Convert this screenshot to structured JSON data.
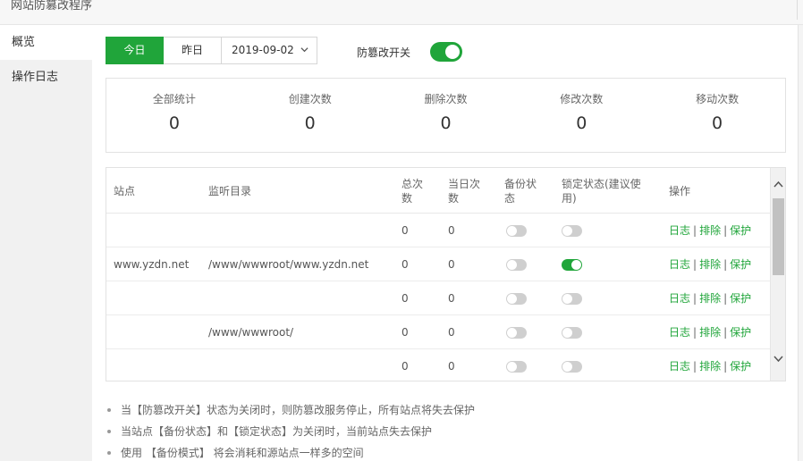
{
  "window": {
    "title": "网站防篡改程序"
  },
  "sidebar": {
    "items": [
      {
        "label": "概览",
        "active": true
      },
      {
        "label": "操作日志",
        "active": false
      }
    ]
  },
  "toolbar": {
    "today_label": "今日",
    "yesterday_label": "昨日",
    "date_value": "2019-09-02",
    "tamper_switch_label": "防篡改开关",
    "tamper_switch_on": true
  },
  "stats": [
    {
      "label": "全部统计",
      "value": "0"
    },
    {
      "label": "创建次数",
      "value": "0"
    },
    {
      "label": "删除次数",
      "value": "0"
    },
    {
      "label": "修改次数",
      "value": "0"
    },
    {
      "label": "移动次数",
      "value": "0"
    }
  ],
  "table": {
    "headers": {
      "site": "站点",
      "dir": "监听目录",
      "total": "总次数",
      "today": "当日次数",
      "backup": "备份状态",
      "lock": "锁定状态(建议使用)",
      "ops": "操作"
    },
    "rows": [
      {
        "site": "",
        "dir": "",
        "total": "0",
        "today": "0",
        "backup_on": false,
        "lock_on": false
      },
      {
        "site": "www.yzdn.net",
        "dir": "/www/wwwroot/www.yzdn.net",
        "total": "0",
        "today": "0",
        "backup_on": false,
        "lock_on": true
      },
      {
        "site": "",
        "dir": "",
        "total": "0",
        "today": "0",
        "backup_on": false,
        "lock_on": false
      },
      {
        "site": "",
        "dir": "/www/wwwroot/",
        "total": "0",
        "today": "0",
        "backup_on": false,
        "lock_on": false
      },
      {
        "site": "",
        "dir": "",
        "total": "0",
        "today": "0",
        "backup_on": false,
        "lock_on": false
      }
    ],
    "actions": {
      "log": "日志",
      "exclude": "排除",
      "protect": "保护",
      "separator": "|"
    }
  },
  "notes": [
    "当【防篡改开关】状态为关闭时，则防篡改服务停止，所有站点将失去保护",
    "当站点【备份状态】和【锁定状态】为关闭时，当前站点失去保护",
    "使用 【备份模式】 将会消耗和源站点一样多的空间"
  ],
  "colors": {
    "accent": "#20a53a",
    "switch_off": "#cfcfcf"
  }
}
